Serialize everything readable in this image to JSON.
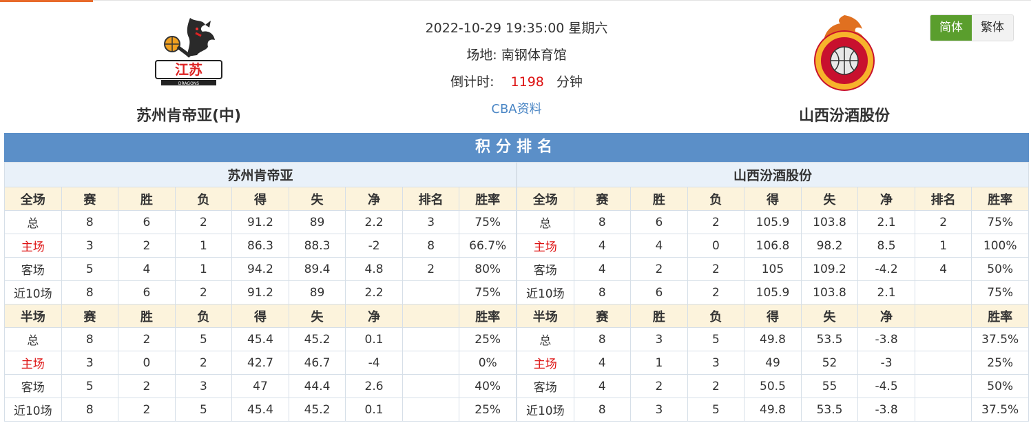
{
  "match": {
    "datetime": "2022-10-29 19:35:00 星期六",
    "venue_label": "场地:",
    "venue": "南钢体育馆",
    "countdown_label": "倒计时:",
    "countdown_value": "1198",
    "countdown_unit": "分钟",
    "link": "CBA资料"
  },
  "home_team": {
    "name": "苏州肯帝亚(中)",
    "logo_icon": "jiangsu-dragons-logo"
  },
  "away_team": {
    "name": "山西汾酒股份",
    "logo_icon": "shanxi-loongs-logo"
  },
  "lang": {
    "simplified": "简体",
    "traditional": "繁体"
  },
  "standings": {
    "title": "积分排名",
    "left": {
      "team": "苏州肯帝亚",
      "full_header": [
        "全场",
        "赛",
        "胜",
        "负",
        "得",
        "失",
        "净",
        "排名",
        "胜率"
      ],
      "full_rows": [
        [
          "总",
          "8",
          "6",
          "2",
          "91.2",
          "89",
          "2.2",
          "3",
          "75%"
        ],
        [
          "主场",
          "3",
          "2",
          "1",
          "86.3",
          "88.3",
          "-2",
          "8",
          "66.7%"
        ],
        [
          "客场",
          "5",
          "4",
          "1",
          "94.2",
          "89.4",
          "4.8",
          "2",
          "80%"
        ],
        [
          "近10场",
          "8",
          "6",
          "2",
          "91.2",
          "89",
          "2.2",
          "",
          "75%"
        ]
      ],
      "half_header": [
        "半场",
        "赛",
        "胜",
        "负",
        "得",
        "失",
        "净",
        "",
        "胜率"
      ],
      "half_rows": [
        [
          "总",
          "8",
          "2",
          "5",
          "45.4",
          "45.2",
          "0.1",
          "",
          "25%"
        ],
        [
          "主场",
          "3",
          "0",
          "2",
          "42.7",
          "46.7",
          "-4",
          "",
          "0%"
        ],
        [
          "客场",
          "5",
          "2",
          "3",
          "47",
          "44.4",
          "2.6",
          "",
          "40%"
        ],
        [
          "近10场",
          "8",
          "2",
          "5",
          "45.4",
          "45.2",
          "0.1",
          "",
          "25%"
        ]
      ]
    },
    "right": {
      "team": "山西汾酒股份",
      "full_header": [
        "全场",
        "赛",
        "胜",
        "负",
        "得",
        "失",
        "净",
        "排名",
        "胜率"
      ],
      "full_rows": [
        [
          "总",
          "8",
          "6",
          "2",
          "105.9",
          "103.8",
          "2.1",
          "2",
          "75%"
        ],
        [
          "主场",
          "4",
          "4",
          "0",
          "106.8",
          "98.2",
          "8.5",
          "1",
          "100%"
        ],
        [
          "客场",
          "4",
          "2",
          "2",
          "105",
          "109.2",
          "-4.2",
          "4",
          "50%"
        ],
        [
          "近10场",
          "8",
          "6",
          "2",
          "105.9",
          "103.8",
          "2.1",
          "",
          "75%"
        ]
      ],
      "half_header": [
        "半场",
        "赛",
        "胜",
        "负",
        "得",
        "失",
        "净",
        "",
        "胜率"
      ],
      "half_rows": [
        [
          "总",
          "8",
          "3",
          "5",
          "49.8",
          "53.5",
          "-3.8",
          "",
          "37.5%"
        ],
        [
          "主场",
          "4",
          "1",
          "3",
          "49",
          "52",
          "-3",
          "",
          "25%"
        ],
        [
          "客场",
          "4",
          "2",
          "2",
          "50.5",
          "55",
          "-4.5",
          "",
          "50%"
        ],
        [
          "近10场",
          "8",
          "3",
          "5",
          "49.8",
          "53.5",
          "-3.8",
          "",
          "37.5%"
        ]
      ]
    }
  }
}
